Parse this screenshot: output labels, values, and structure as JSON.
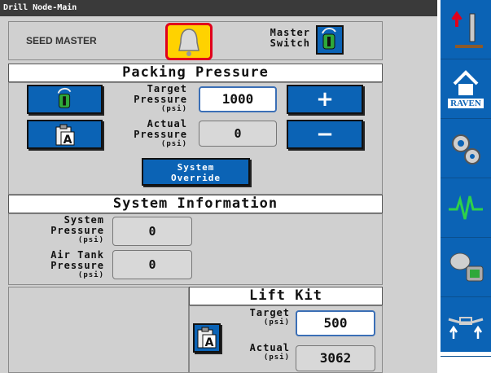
{
  "window": {
    "title": "Drill Node-Main"
  },
  "header": {
    "brand": "SEED MASTER",
    "master_switch_label_1": "Master",
    "master_switch_label_2": "Switch",
    "alarm_icon": "bell-icon"
  },
  "packing": {
    "title": "Packing Pressure",
    "target_label_1": "Target",
    "target_label_2": "Pressure",
    "target_unit": "(psi)",
    "target_value": "1000",
    "actual_label_1": "Actual",
    "actual_label_2": "Pressure",
    "actual_unit": "(psi)",
    "actual_value": "0",
    "plus_label": "+",
    "minus_label": "−",
    "override_label_1": "System",
    "override_label_2": "Override"
  },
  "system_info": {
    "title": "System Information",
    "system_label_1": "System",
    "system_label_2": "Pressure",
    "system_unit": "(psi)",
    "system_value": "0",
    "air_label_1": "Air Tank",
    "air_label_2": "Pressure",
    "air_unit": "(psi)",
    "air_value": "0"
  },
  "lift_kit": {
    "title": "Lift Kit",
    "target_label": "Target",
    "target_unit": "(psi)",
    "target_value": "500",
    "actual_label": "Actual",
    "actual_unit": "(psi)",
    "actual_value": "3062"
  },
  "sidebar": {
    "raven_label": "RAVEN",
    "items": [
      "implement-lift-icon",
      "raven-home-icon",
      "gears-icon",
      "diagnostics-icon",
      "joystick-icon",
      "sprayer-boom-icon"
    ]
  },
  "colors": {
    "accent_blue": "#0b63b5",
    "alarm_yellow": "#ffd200",
    "alarm_red": "#e0001b",
    "panel_gray": "#d0d0d0"
  }
}
